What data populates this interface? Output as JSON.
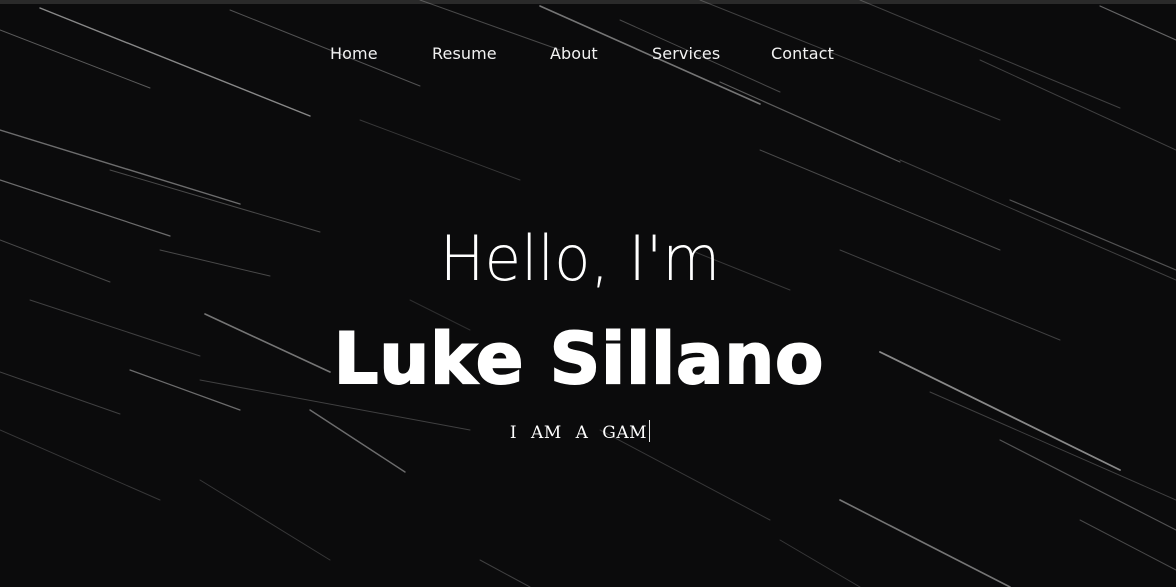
{
  "nav": {
    "items": [
      {
        "label": "Home"
      },
      {
        "label": "Resume"
      },
      {
        "label": "About"
      },
      {
        "label": "Services"
      },
      {
        "label": "Contact"
      }
    ]
  },
  "hero": {
    "greeting": "Hello, I'm",
    "name": "Luke Sillano",
    "typed_text": "I AM A GAM"
  },
  "colors": {
    "background": "#0b0b0c",
    "text": "#ffffff",
    "streak": "#c8c8c8"
  }
}
